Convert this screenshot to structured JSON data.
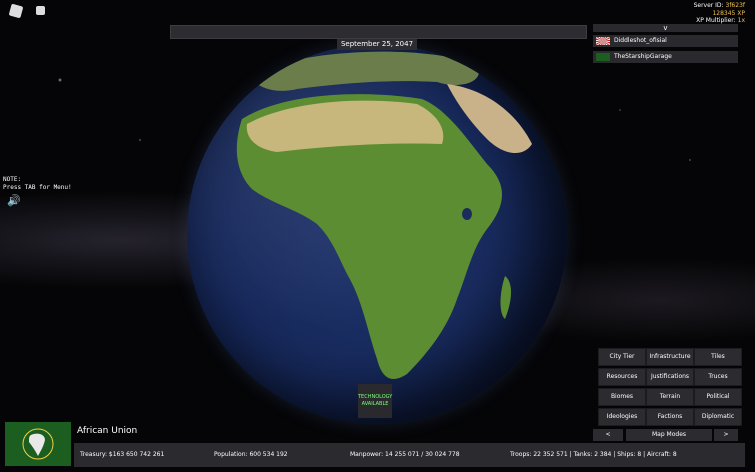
{
  "server": {
    "id_label": "Server ID:",
    "id_value": "3f623f",
    "xp_value": "128345",
    "xp_label": "XP",
    "multiplier_label": "XP Multiplier:",
    "multiplier_value": "1x"
  },
  "date": "September 25, 2047",
  "players": {
    "toggle": "v",
    "list": [
      {
        "name": "Diddleshot_ofisial",
        "flag": "rising-sun-flag"
      },
      {
        "name": "TheStarshipGarage",
        "flag": "african-union-flag"
      }
    ]
  },
  "note": {
    "line1": "NOTE:",
    "line2": "Press TAB for Menu!"
  },
  "technology": {
    "line1": "TECHNOLOGY",
    "line2": "AVAILABLE"
  },
  "map_modes": {
    "buttons": [
      [
        "City Tier",
        "Infrastructure",
        "Tiles"
      ],
      [
        "Resources",
        "Justifications",
        "Truces"
      ],
      [
        "Biomes",
        "Terrain",
        "Political"
      ],
      [
        "Ideologies",
        "Factions",
        "Diplomatic"
      ]
    ],
    "prev": "<",
    "label": "Map Modes",
    "next": ">"
  },
  "country": {
    "name": "African Union",
    "flag_color": "#1b5e20"
  },
  "stats": {
    "treasury": "Treasury:  $163 650 742 261",
    "population": "Population: 600 534 192",
    "manpower": "Manpower:  14 255 071  /  30 024 778",
    "military": "Troops: 22 352 571  |  Tanks: 2 384  |  Ships: 8  |  Aircraft: 8"
  }
}
